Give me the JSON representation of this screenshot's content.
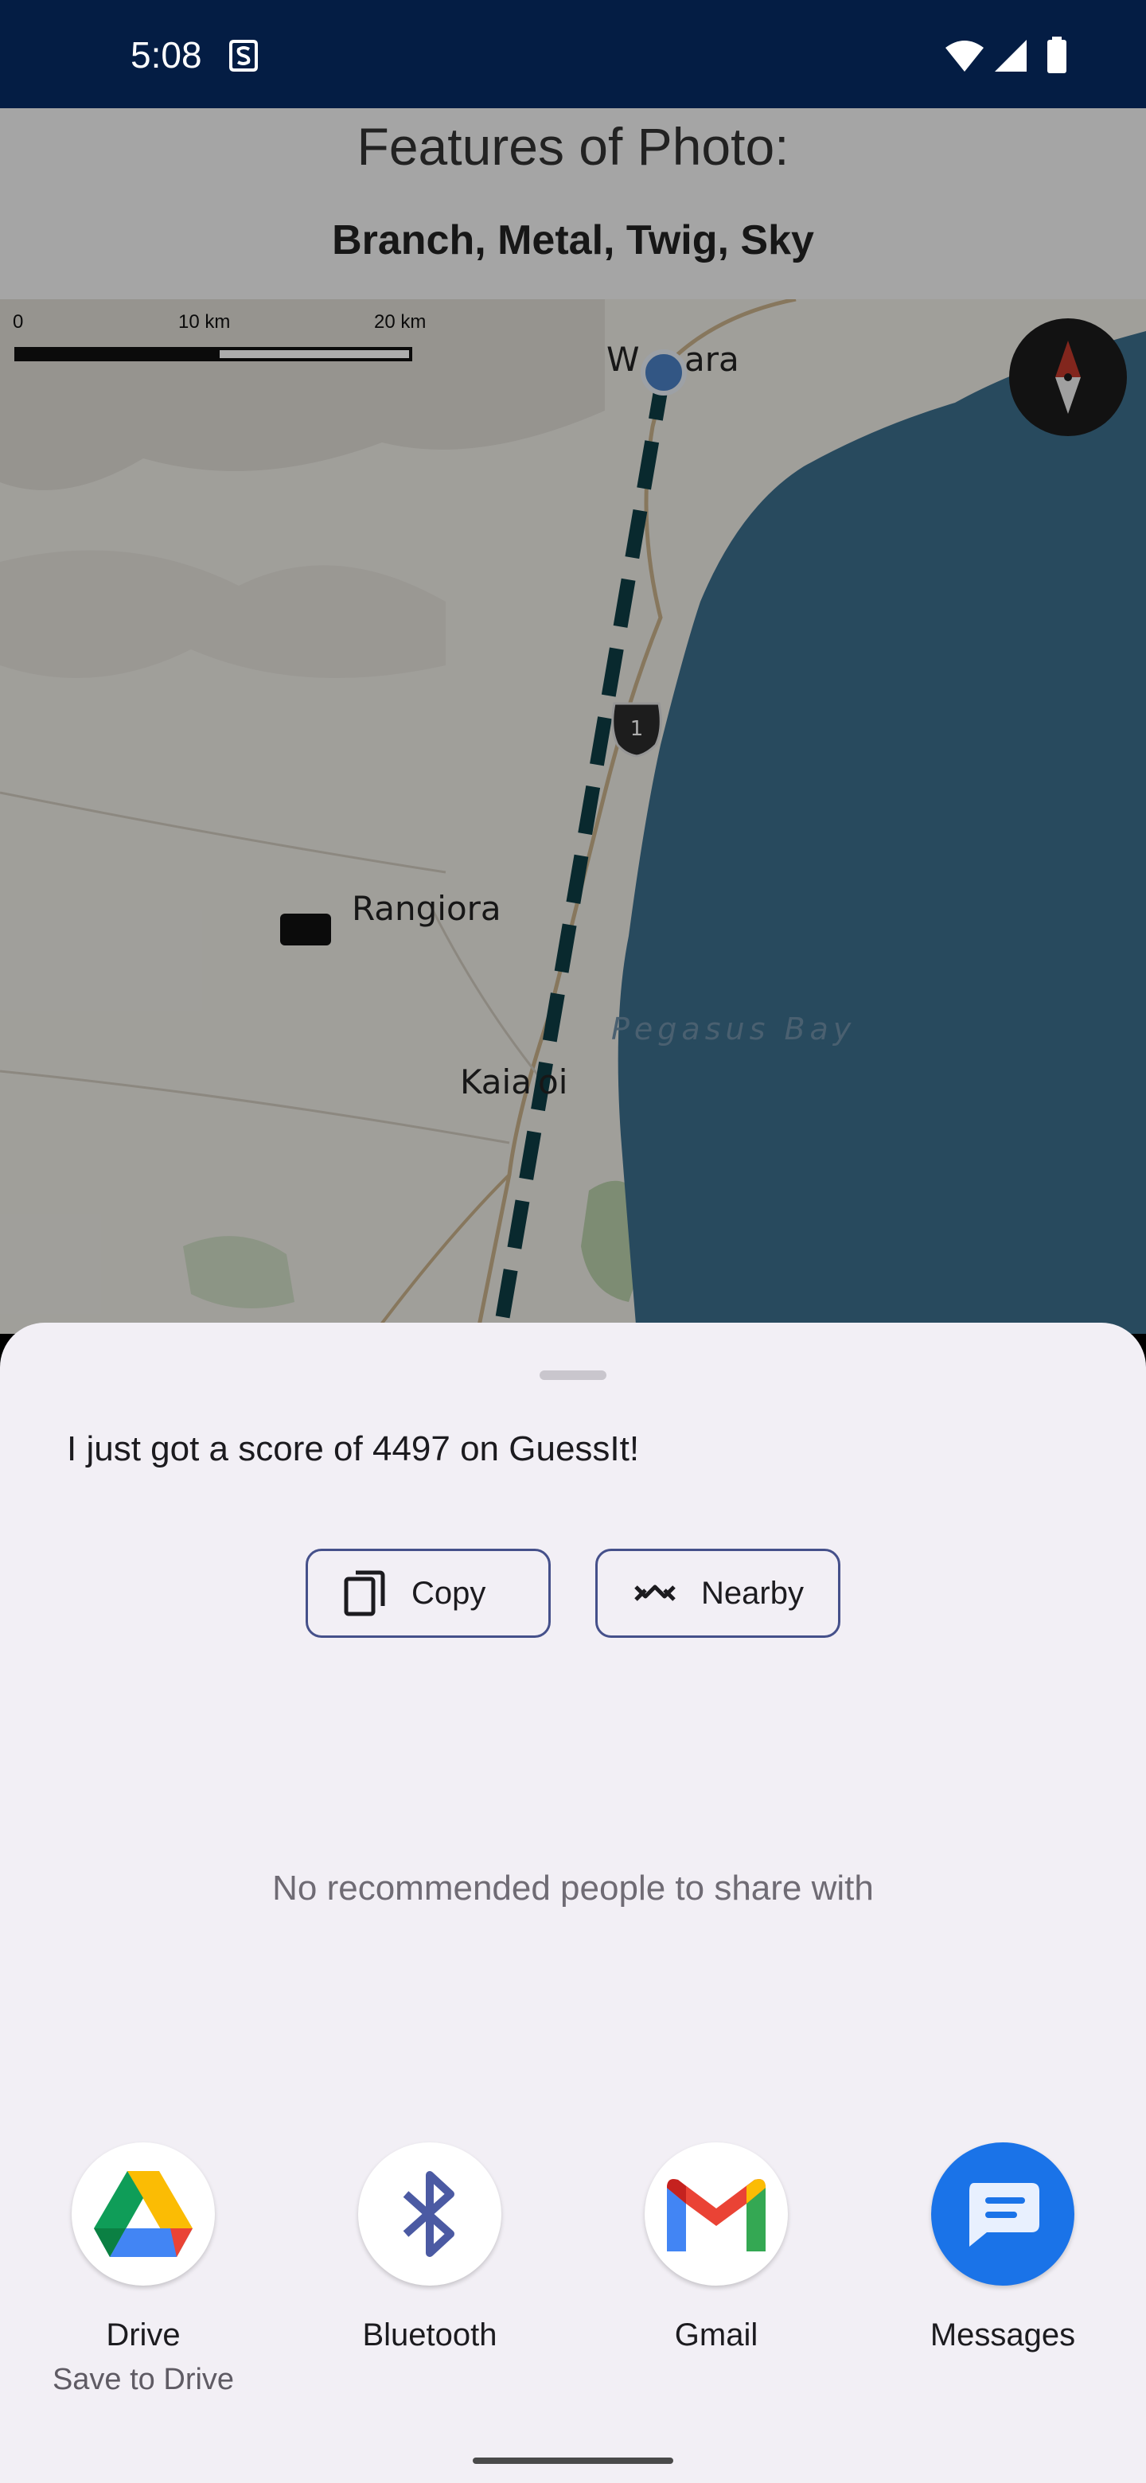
{
  "status_bar": {
    "time": "5:08"
  },
  "app": {
    "features_title": "Features of Photo:",
    "features": "Branch, Metal, Twig, Sky"
  },
  "map": {
    "scale_labels": [
      "0",
      "10 km",
      "20 km"
    ],
    "places": [
      "W",
      "ara",
      "Rangiora",
      "Kaia",
      "oi"
    ],
    "water_label": "Pegasus Bay",
    "highway_shield": "1"
  },
  "sheet": {
    "share_text": "I just got a score of 4497 on GuessIt!",
    "copy_label": "Copy",
    "nearby_label": "Nearby",
    "no_people": "No recommended people to share with",
    "targets": [
      {
        "name": "Drive",
        "sub": "Save to Drive",
        "icon": "google-drive-icon"
      },
      {
        "name": "Bluetooth",
        "icon": "bluetooth-icon"
      },
      {
        "name": "Gmail",
        "icon": "gmail-icon"
      },
      {
        "name": "Messages",
        "icon": "messages-icon"
      }
    ]
  },
  "colors": {
    "status_bar": "#041d44",
    "chip_border": "#45508a",
    "sheet_bg": "#f2eff5",
    "route": "#0e3d45",
    "sea": "#3b6d8b"
  }
}
